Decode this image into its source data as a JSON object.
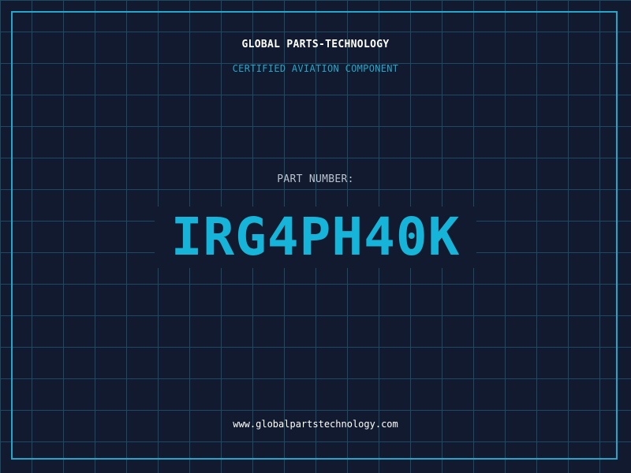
{
  "brand": "GLOBAL PARTS-TECHNOLOGY",
  "tagline": "CERTIFIED AVIATION COMPONENT",
  "part": {
    "label": "PART NUMBER:",
    "number": "IRG4PH40K"
  },
  "website": "www.globalpartstechnology.com",
  "colors": {
    "background": "#111a2e",
    "grid": "#1d4a63",
    "accent": "#23a6c9",
    "part_number": "#15b4d8",
    "text": "#ffffff",
    "muted": "#b9c3d0"
  }
}
